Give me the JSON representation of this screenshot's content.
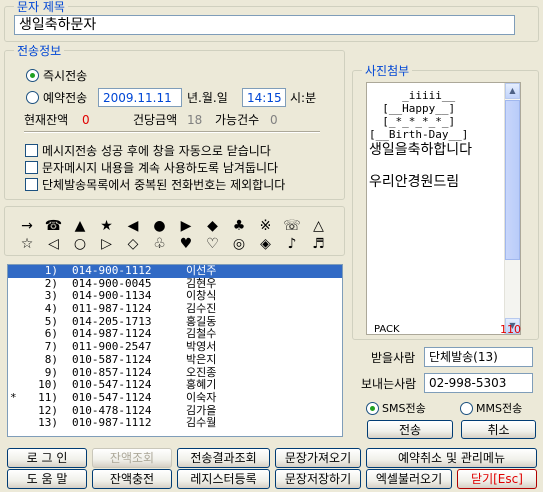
{
  "message_title": {
    "legend": "문자 제목",
    "value": "생일축하문자"
  },
  "send_info": {
    "legend": "전송정보",
    "immediate_label": "즉시전송",
    "reserved_label": "예약전송",
    "date_value": "2009.11.11",
    "date_suffix": "년.월.일",
    "time_value": "14:15",
    "time_suffix": "시:분",
    "balance_label": "현재잔액",
    "balance_value": "0",
    "unit_price_label": "건당금액",
    "unit_price_value": "18",
    "available_label": "가능건수",
    "available_value": "0",
    "options": [
      {
        "label": "메시지전송 성공 후에 창을 자동으로 닫습니다",
        "checked": false
      },
      {
        "label": "문자메시지 내용을 계속 사용하도록 남겨둡니다",
        "checked": false
      },
      {
        "label": "단체발송목록에서 중복된 전화번호는 제외합니다",
        "checked": false
      }
    ]
  },
  "symbols": {
    "row1": [
      "→",
      "☎",
      "▲",
      "★",
      "◀",
      "●",
      "▶",
      "◆",
      "♣",
      "※",
      "☏",
      "△"
    ],
    "row2": [
      "☆",
      "◁",
      "○",
      "▷",
      "◇",
      "♧",
      "♥",
      "♡",
      "◎",
      "◈",
      "♪",
      "♬"
    ]
  },
  "recipients": [
    {
      "marker": "",
      "no": "1)",
      "phone": "014-900-1112",
      "name": "이선주",
      "selected": true
    },
    {
      "marker": "",
      "no": "2)",
      "phone": "014-900-0045",
      "name": "김현우",
      "selected": false
    },
    {
      "marker": "",
      "no": "3)",
      "phone": "014-900-1134",
      "name": "이창식",
      "selected": false
    },
    {
      "marker": "",
      "no": "4)",
      "phone": "011-987-1124",
      "name": "김수진",
      "selected": false
    },
    {
      "marker": "",
      "no": "5)",
      "phone": "014-205-1713",
      "name": "홍길동",
      "selected": false
    },
    {
      "marker": "",
      "no": "6)",
      "phone": "014-987-1124",
      "name": "김철수",
      "selected": false
    },
    {
      "marker": "",
      "no": "7)",
      "phone": "011-900-2547",
      "name": "박영서",
      "selected": false
    },
    {
      "marker": "",
      "no": "8)",
      "phone": "010-587-1124",
      "name": "박은지",
      "selected": false
    },
    {
      "marker": "",
      "no": "9)",
      "phone": "010-857-1124",
      "name": "오진종",
      "selected": false
    },
    {
      "marker": "",
      "no": "10)",
      "phone": "010-547-1124",
      "name": "홍혜기",
      "selected": false
    },
    {
      "marker": "*",
      "no": "11)",
      "phone": "010-547-1124",
      "name": "이숙자",
      "selected": false
    },
    {
      "marker": "",
      "no": "12)",
      "phone": "010-478-1124",
      "name": "김가을",
      "selected": false
    },
    {
      "marker": "",
      "no": "13)",
      "phone": "010-987-1112",
      "name": "김수월",
      "selected": false
    }
  ],
  "photo": {
    "legend": "사진첨부",
    "art": "     _iiiii__\n  [__Happy__]\n  [_*_*_*_*_]\n[__Birth-Day__]",
    "line1": "생일을축하합니다",
    "line2": "우리안경원드림",
    "pack_label": "PACK",
    "pack_count": "110"
  },
  "receiver": {
    "label": "받을사람",
    "value": "단체발송(13)"
  },
  "sender": {
    "label": "보내는사람",
    "value": "02-998-5303"
  },
  "send_type": {
    "sms_label": "SMS전송",
    "mms_label": "MMS전송",
    "selected": "SMS"
  },
  "buttons": {
    "send": "전송",
    "cancel": "취소",
    "login": "로 그 인",
    "balance_check": "잔액조회",
    "send_result": "전송결과조회",
    "load_message": "문장가져오기",
    "reservation": "예약취소 및 관리메뉴",
    "help": "도 움 말",
    "recharge": "잔액충전",
    "registry": "레지스터등록",
    "save_message": "문장저장하기",
    "excel_import": "엑셀불러오기",
    "close": "닫기[Esc]"
  },
  "colors": {
    "accent": "#0046D5",
    "balance_red": "#E00000",
    "selection": "#316AC5",
    "window_bg": "#ECE9D8"
  }
}
